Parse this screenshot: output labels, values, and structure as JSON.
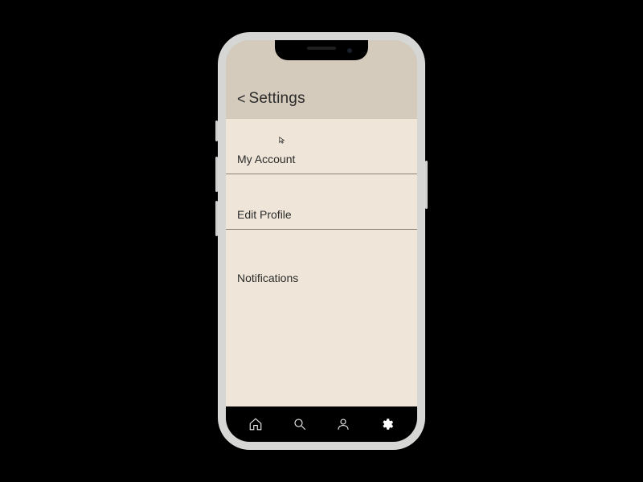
{
  "header": {
    "back_glyph": "<",
    "title": "Settings"
  },
  "items": [
    {
      "label": "My Account"
    },
    {
      "label": "Edit Profile"
    },
    {
      "label": "Notifications"
    }
  ],
  "tabbar": {
    "icons": [
      "home-icon",
      "search-icon",
      "profile-icon",
      "settings-icon"
    ],
    "active": "settings-icon"
  }
}
